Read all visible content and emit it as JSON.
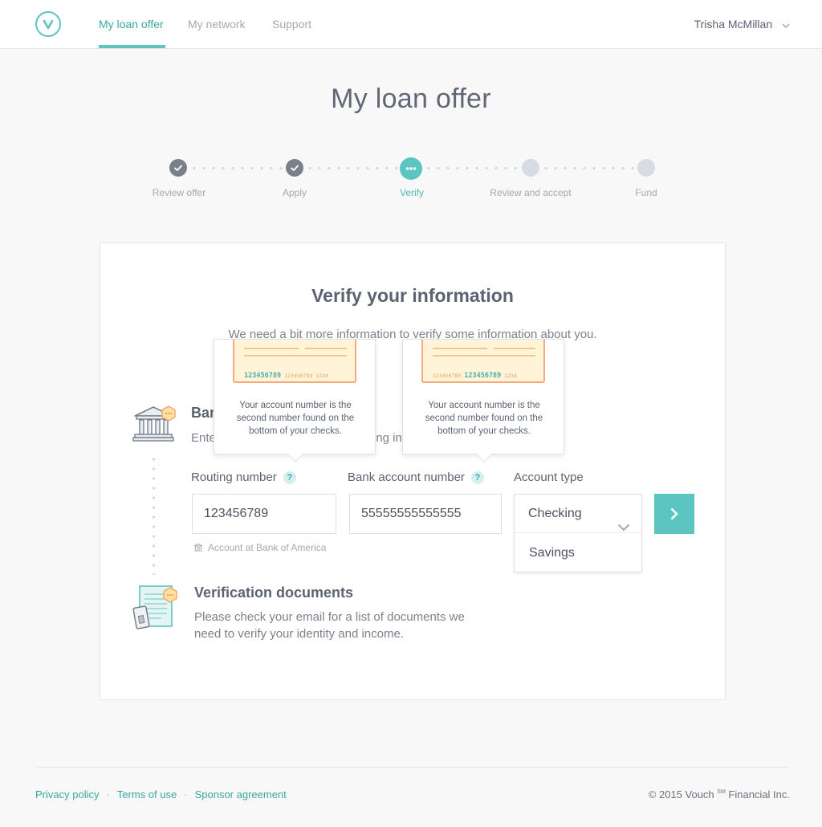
{
  "header": {
    "nav": [
      "My loan offer",
      "My network",
      "Support"
    ],
    "active_index": 0,
    "user_name": "Trisha McMillan"
  },
  "page_title": "My loan offer",
  "stepper": {
    "steps": [
      {
        "label": "Review offer",
        "state": "done"
      },
      {
        "label": "Apply",
        "state": "done"
      },
      {
        "label": "Verify",
        "state": "current"
      },
      {
        "label": "Review and accept",
        "state": "todo"
      },
      {
        "label": "Fund",
        "state": "todo"
      }
    ]
  },
  "card": {
    "title": "Verify your information",
    "subtitle_line1": "We need a bit more information to verify some information about you.",
    "subtitle_line2_visible": "inform"
  },
  "bank_section": {
    "title_visible": "Ban",
    "text_visible_left": "Ente",
    "text_visible_right": "ing in",
    "routing_label": "Routing number",
    "routing_value": "123456789",
    "bank_hint": "Account at Bank of America",
    "account_label": "Bank account number",
    "account_value": "55555555555555",
    "type_label": "Account type",
    "type_selected": "Checking",
    "type_option": "Savings",
    "help_glyph": "?"
  },
  "tooltips": [
    {
      "check_numbers": [
        "123456789",
        "123456789",
        "1234"
      ],
      "text": "Your account number is the second number found on the bottom of your checks."
    },
    {
      "check_numbers": [
        "123456789",
        "123456789",
        "1234"
      ],
      "text": "Your account number is the second number found on the bottom of your checks."
    }
  ],
  "documents_section": {
    "title": "Verification documents",
    "text_line1": "Please check your email for a list of documents we",
    "text_line2": "need to verify your identity and income."
  },
  "footer": {
    "links": [
      "Privacy policy",
      "Terms of use",
      "Sponsor agreement"
    ],
    "separator": "·",
    "copyright_prefix": "© 2015 Vouch",
    "copyright_mark": "SM",
    "copyright_suffix": " Financial Inc."
  },
  "colors": {
    "accent": "#5cc5c2",
    "accent_text": "#3aa7a3",
    "step_done": "#7a7f8c",
    "step_todo": "#d7dbe3",
    "check_bg": "#fff3d8",
    "check_border": "#f5a97c"
  },
  "icons": {
    "logo": "vouch-v-logo",
    "user_chevron": "chevron-down-icon",
    "step_done": "check-icon",
    "step_current": "dots-icon",
    "bank": "bank-building-icon",
    "documents": "document-card-icon",
    "next": "chevron-right-icon"
  }
}
